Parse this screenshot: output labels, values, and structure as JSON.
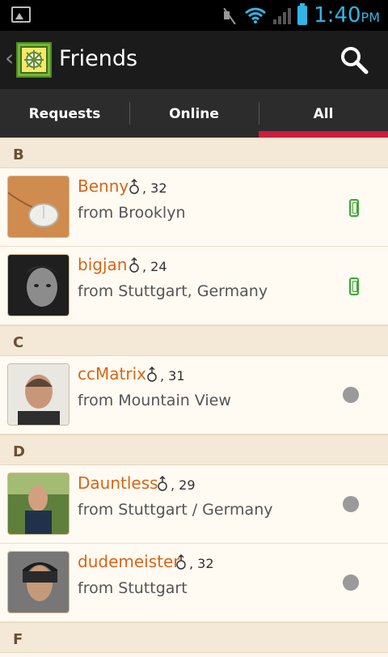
{
  "status": {
    "time": "1:40",
    "period": "PM"
  },
  "header": {
    "title": "Friends"
  },
  "tabs": [
    {
      "label": "Requests"
    },
    {
      "label": "Online"
    },
    {
      "label": "All"
    }
  ],
  "sections": [
    {
      "letter": "B",
      "friends": [
        {
          "name": "Benny",
          "age_text": ", 32",
          "location": "from Brooklyn",
          "status": "mobile-online-icon"
        },
        {
          "name": "bigjan",
          "age_text": ", 24",
          "location": "from Stuttgart, Germany",
          "status": "mobile-online-icon"
        }
      ]
    },
    {
      "letter": "C",
      "friends": [
        {
          "name": "ccMatrix",
          "age_text": ", 31",
          "location": "from Mountain View",
          "status": "offline-dot-icon"
        }
      ]
    },
    {
      "letter": "D",
      "friends": [
        {
          "name": "Dauntless",
          "age_text": ", 29",
          "location": "from Stuttgart / Germany",
          "status": "offline-dot-icon"
        },
        {
          "name": "dudemeister",
          "age_text": ", 32",
          "location": "from Stuttgart",
          "status": "offline-dot-icon"
        }
      ]
    },
    {
      "letter": "F",
      "friends": []
    }
  ],
  "colors": {
    "accent": "#cc1d3c",
    "name": "#d66616",
    "online": "#39a92b",
    "offline": "#9a9a9a"
  }
}
